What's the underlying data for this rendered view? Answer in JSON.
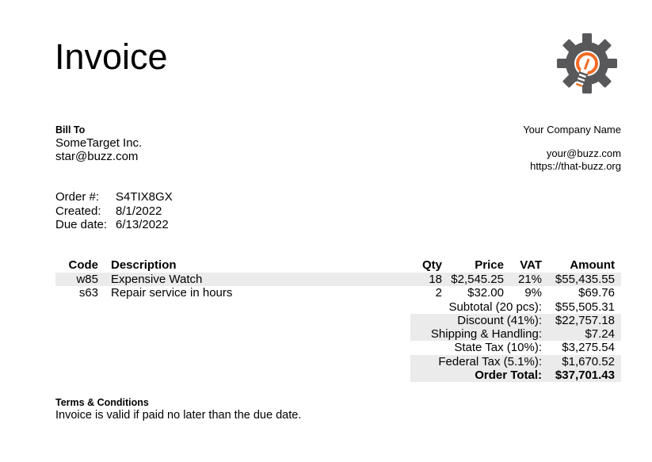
{
  "invoice": {
    "title": "Invoice"
  },
  "bill_to": {
    "label": "Bill To",
    "name": "SomeTarget Inc.",
    "email": "star@buzz.com"
  },
  "company": {
    "name": "Your Company Name",
    "email": "your@buzz.com",
    "website": "https://that-buzz.org"
  },
  "order": {
    "number_label": "Order #:",
    "number": "S4TIX8GX",
    "created_label": "Created:",
    "created": "8/1/2022",
    "due_label": "Due date:",
    "due": "6/13/2022"
  },
  "table": {
    "headers": {
      "code": "Code",
      "description": "Description",
      "qty": "Qty",
      "price": "Price",
      "vat": "VAT",
      "amount": "Amount"
    },
    "rows": [
      {
        "code": "w85",
        "description": "Expensive Watch",
        "qty": "18",
        "price": "$2,545.25",
        "vat": "21%",
        "amount": "$55,435.55"
      },
      {
        "code": "s63",
        "description": "Repair service in hours",
        "qty": "2",
        "price": "$32.00",
        "vat": "9%",
        "amount": "$69.76"
      }
    ]
  },
  "summary": {
    "subtotal_label": "Subtotal (20 pcs):",
    "subtotal": "$55,505.31",
    "discount_label": "Discount (41%):",
    "discount": "$22,757.18",
    "shipping_label": "Shipping & Handling:",
    "shipping": "$7.24",
    "state_tax_label": "State Tax (10%):",
    "state_tax": "$3,275.54",
    "federal_tax_label": "Federal Tax (5.1%):",
    "federal_tax": "$1,670.52",
    "total_label": "Order Total:",
    "total": "$37,701.43"
  },
  "terms": {
    "label": "Terms & Conditions",
    "text": "Invoice is valid if paid no later than the due date."
  },
  "colors": {
    "logo_gear": "#58585a",
    "logo_accent": "#f26a24"
  },
  "icons": {
    "logo": "gear-lightbulb-logo-icon"
  }
}
